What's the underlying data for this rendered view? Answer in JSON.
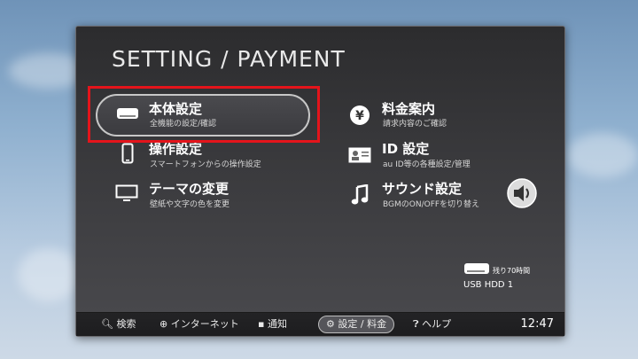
{
  "header": {
    "title": "SETTING / PAYMENT"
  },
  "menu": {
    "left": [
      {
        "label": "本体設定",
        "sub": "全機能の設定/確認",
        "icon": "console-icon"
      },
      {
        "label": "操作設定",
        "sub": "スマートフォンからの操作設定",
        "icon": "smartphone-icon"
      },
      {
        "label": "テーマの変更",
        "sub": "壁紙や文字の色を変更",
        "icon": "monitor-icon"
      }
    ],
    "right": [
      {
        "label": "料金案内",
        "sub": "請求内容のご確認",
        "icon": "yen-icon"
      },
      {
        "label": "ID 設定",
        "sub": "au ID等の各種設定/管理",
        "icon": "id-card-icon"
      },
      {
        "label": "サウンド設定",
        "sub": "BGMのON/OFFを切り替え",
        "icon": "music-note-icon"
      }
    ]
  },
  "storage": {
    "remaining": "残り70時間",
    "device": "USB HDD 1"
  },
  "bottom_bar": {
    "tabs": [
      "検索",
      "インターネット",
      "通知",
      "設定 / 料金",
      "ヘルプ"
    ],
    "active_tab": "設定 / 料金",
    "time": "12:47"
  },
  "colors": {
    "highlight": "#e4141b",
    "panel": "#333336"
  }
}
